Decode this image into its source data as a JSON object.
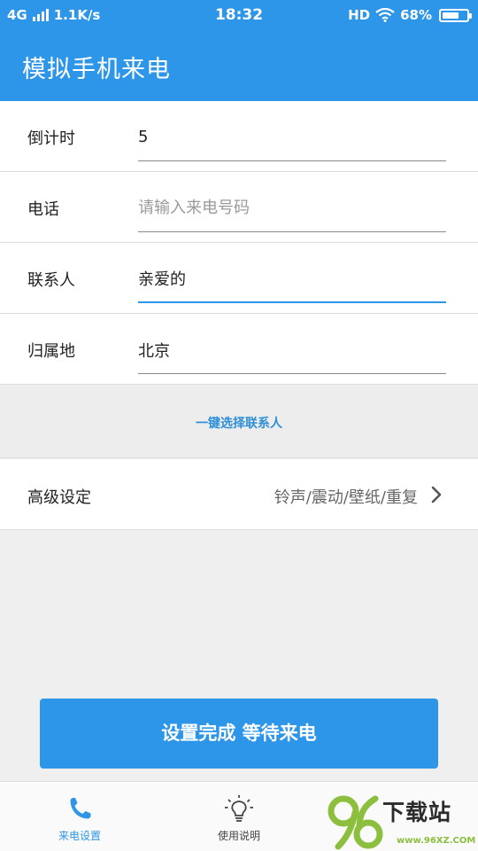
{
  "status_bar": {
    "network": "4G",
    "speed": "1.1K/s",
    "time": "18:32",
    "hd": "HD",
    "battery_percent": "68%",
    "battery_level": 0.68
  },
  "app_bar": {
    "title": "模拟手机来电"
  },
  "form": {
    "countdown": {
      "label": "倒计时",
      "value": "5"
    },
    "phone": {
      "label": "电话",
      "value": "",
      "placeholder": "请输入来电号码"
    },
    "contact": {
      "label": "联系人",
      "value": "亲爱的"
    },
    "location": {
      "label": "归属地",
      "value": "北京"
    }
  },
  "pick_contact": {
    "label": "一键选择联系人"
  },
  "advanced": {
    "label": "高级设定",
    "value": "铃声/震动/壁纸/重复"
  },
  "primary_button": {
    "label": "设置完成 等待来电"
  },
  "bottom_nav": {
    "items": [
      {
        "label": "来电设置",
        "icon": "phone-icon",
        "active": true
      },
      {
        "label": "使用说明",
        "icon": "lightbulb-icon",
        "active": false
      }
    ]
  },
  "watermark": {
    "logo_digits": "96",
    "text": "下载站",
    "url": "www.96XZ.COM"
  },
  "colors": {
    "primary": "#2e96e8",
    "background": "#efefef",
    "watermark_green": "#8bbf3d"
  }
}
